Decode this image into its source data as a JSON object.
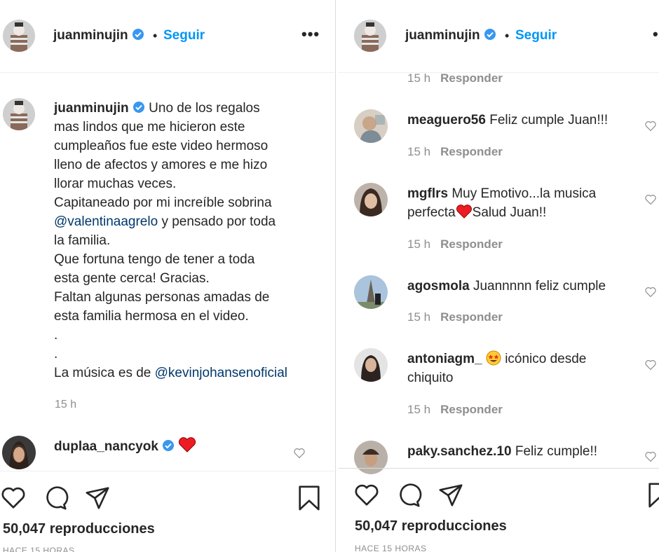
{
  "post": {
    "username": "juanminujin",
    "separator": "•",
    "follow_label": "Seguir",
    "more_label": "•••",
    "caption_lines": [
      "Uno de los regalos",
      "mas lindos que me hicieron este",
      "cumpleaños fue este video hermoso",
      "lleno de afectos y amores e me hizo",
      "llorar muchas veces.",
      "Capitaneado por mi increíble sobrina",
      "@valentinaagrelo",
      " y pensado por toda",
      "la familia.",
      "Que fortuna tengo de tener a toda",
      "esta gente cerca! Gracias.",
      "Faltan algunas personas amadas de",
      "esta familia hermosa en el video.",
      ".",
      ".",
      "La música es de ",
      "@kevinjohansenoficial"
    ],
    "caption_time": "15 h",
    "views": "50,047 reproducciones",
    "posted_ago": "HACE 15 HORAS"
  },
  "left_comments": [
    {
      "user": "duplaa_nancyok",
      "text": ""
    }
  ],
  "right_comments": {
    "top_meta": {
      "time": "15 h",
      "reply": "Responder"
    },
    "items": [
      {
        "user": "meaguero56",
        "text": "Feliz cumple Juan!!!",
        "time": "15 h",
        "reply": "Responder"
      },
      {
        "user": "mgflrs",
        "text_line1": "Muy Emotivo...la musica",
        "text_line2a": "perfecta",
        "text_line2b": "Salud Juan!!",
        "time": "15 h",
        "reply": "Responder"
      },
      {
        "user": "agosmola",
        "text": "Juannnnn feliz cumple",
        "time": "15 h",
        "reply": "Responder"
      },
      {
        "user": "antoniagm_",
        "text_line1": "icónico desde",
        "text_line2": "chiquito",
        "time": "15 h",
        "reply": "Responder"
      },
      {
        "user": "paky.sanchez.10",
        "text": "Feliz cumple!!"
      }
    ]
  },
  "colors": {
    "link_blue": "#0095f6",
    "mention_blue": "#00376b",
    "verified_blue": "#3897f0",
    "text_grey": "#8e8e8e",
    "heart_red": "#ed4956"
  },
  "icons": [
    "verified-badge-icon",
    "like-icon",
    "comment-icon",
    "share-icon",
    "save-icon",
    "heart-emoji-icon",
    "star-eyes-emoji-icon"
  ]
}
